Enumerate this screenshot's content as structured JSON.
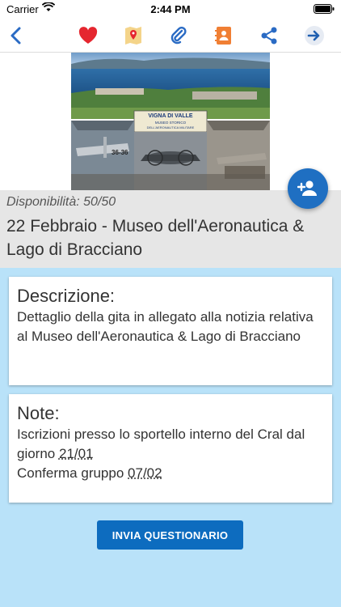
{
  "status": {
    "carrier": "Carrier",
    "time": "2:44 PM"
  },
  "toolbar": {
    "icons": [
      "back-chevron-icon",
      "heart-icon",
      "map-pin-icon",
      "paperclip-icon",
      "contact-book-icon",
      "share-icon",
      "arrow-right-icon"
    ],
    "accent_color": "#2a6bc4",
    "heart_color": "#e5262f",
    "contact_color": "#f07f34"
  },
  "hero": {
    "sign_line1": "VIGNA DI VALLE",
    "sign_line2": "MUSEO STORICO",
    "sign_line3": "DELL'AERONAUTICA MILITARE",
    "plane_code": "36-36"
  },
  "trip": {
    "availability": "Disponibilità: 50/50",
    "title": "22 Febbraio - Museo dell'Aeronautica & Lago di Bracciano"
  },
  "description": {
    "title": "Descrizione:",
    "text": "Dettaglio della gita in allegato alla notizia relativa al Museo dell'Aeronautica & Lago di Bracciano"
  },
  "notes": {
    "title": "Note:",
    "line1_prefix": "Iscrizioni presso lo sportello interno del Cral dal giorno ",
    "line1_date": "21/01",
    "line2_prefix": "Conferma gruppo ",
    "line2_date": "07/02"
  },
  "actions": {
    "submit_label": "INVIA QUESTIONARIO",
    "add_person_icon": "add-person-icon"
  }
}
